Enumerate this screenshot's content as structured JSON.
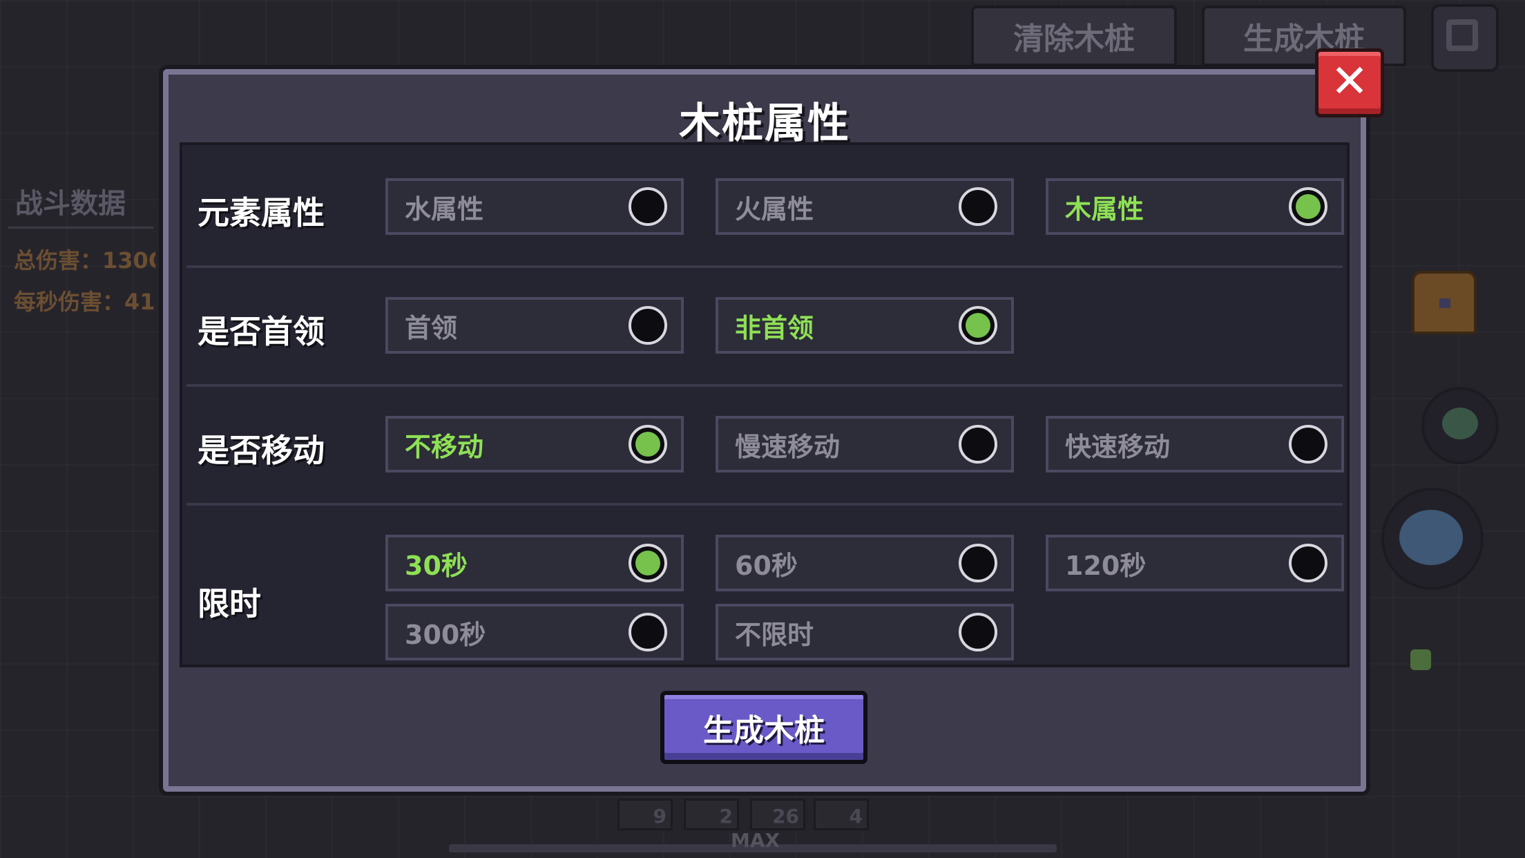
{
  "background": {
    "top_buttons": {
      "clear_stump": "清除木桩",
      "generate_stump": "生成木桩"
    },
    "battle_panel": {
      "title": "战斗数据",
      "total_damage": "总伤害：130C",
      "dps": "每秒伤害：41"
    },
    "inventory_counts": [
      "9",
      "2",
      "26",
      "4"
    ],
    "level_label": "MAX"
  },
  "dialog": {
    "title": "木桩属性",
    "close_label": "✕",
    "rows": {
      "element": {
        "label": "元素属性",
        "options": [
          {
            "label": "水属性",
            "selected": false
          },
          {
            "label": "火属性",
            "selected": false
          },
          {
            "label": "木属性",
            "selected": true
          }
        ]
      },
      "boss": {
        "label": "是否首领",
        "options": [
          {
            "label": "首领",
            "selected": false
          },
          {
            "label": "非首领",
            "selected": true
          }
        ]
      },
      "movement": {
        "label": "是否移动",
        "options": [
          {
            "label": "不移动",
            "selected": true
          },
          {
            "label": "慢速移动",
            "selected": false
          },
          {
            "label": "快速移动",
            "selected": false
          }
        ]
      },
      "time_limit": {
        "label": "限时",
        "options": [
          {
            "label": "30秒",
            "selected": true
          },
          {
            "label": "60秒",
            "selected": false
          },
          {
            "label": "120秒",
            "selected": false
          },
          {
            "label": "300秒",
            "selected": false
          },
          {
            "label": "不限时",
            "selected": false
          }
        ]
      }
    },
    "generate_button": "生成木桩"
  },
  "colors": {
    "selected_text": "#8ee055",
    "selected_radio": "#76c24c",
    "close_button": "#d8343a",
    "generate_button": "#6a5ac7"
  }
}
